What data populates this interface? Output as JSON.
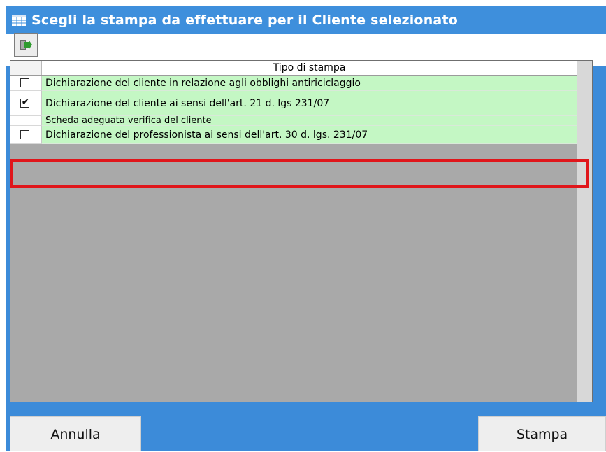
{
  "window": {
    "title": "Scegli la stampa da effettuare per il Cliente selezionato",
    "title_icon": "grid-window-icon",
    "accent_color": "#3e8fdc"
  },
  "toolbar": {
    "export_button_icon": "export-arrow-icon"
  },
  "grid": {
    "column_header": "Tipo di stampa",
    "rows": [
      {
        "label": "Dichiarazione del cliente in relazione agli obblighi antiriciclaggio",
        "checked": false
      },
      {
        "label": "Dichiarazione del cliente ai sensi dell'art. 21 d. lgs 231/07",
        "checked": true
      },
      {
        "label": "Scheda adeguata verifica del cliente",
        "checked": false
      },
      {
        "label": "Dichiarazione del professionista ai sensi dell'art. 30 d. lgs. 231/07",
        "checked": false
      }
    ],
    "row_color": "#c4f7c4",
    "highlight_color": "#e0161b"
  },
  "footer": {
    "cancel_label": "Annulla",
    "print_label": "Stampa"
  }
}
